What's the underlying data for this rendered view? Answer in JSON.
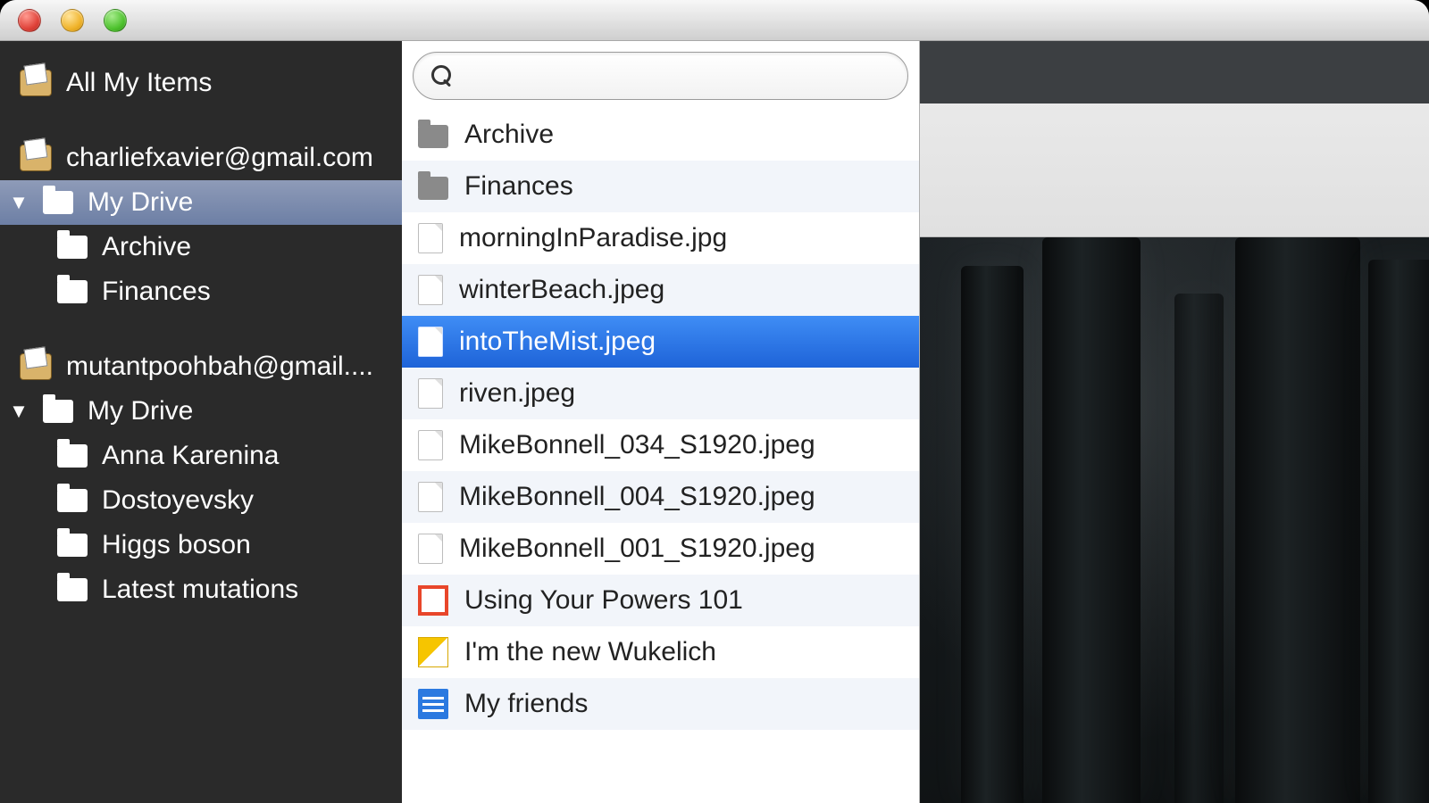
{
  "sidebar": {
    "all_items_label": "All My Items",
    "accounts": [
      {
        "email": "charliefxavier@gmail.com",
        "drive_label": "My Drive",
        "selected": true,
        "folders": [
          "Archive",
          "Finances"
        ]
      },
      {
        "email": "mutantpoohbah@gmail....",
        "drive_label": "My Drive",
        "selected": false,
        "folders": [
          "Anna Karenina",
          "Dostoyevsky",
          "Higgs boson",
          "Latest mutations"
        ]
      }
    ]
  },
  "search": {
    "placeholder": ""
  },
  "files": [
    {
      "name": "Archive",
      "type": "folder",
      "selected": false
    },
    {
      "name": "Finances",
      "type": "folder",
      "selected": false
    },
    {
      "name": "morningInParadise.jpg",
      "type": "file",
      "selected": false
    },
    {
      "name": "winterBeach.jpeg",
      "type": "file",
      "selected": false
    },
    {
      "name": "intoTheMist.jpeg",
      "type": "file",
      "selected": true
    },
    {
      "name": "riven.jpeg",
      "type": "file",
      "selected": false
    },
    {
      "name": "MikeBonnell_034_S1920.jpeg",
      "type": "file",
      "selected": false
    },
    {
      "name": "MikeBonnell_004_S1920.jpeg",
      "type": "file",
      "selected": false
    },
    {
      "name": "MikeBonnell_001_S1920.jpeg",
      "type": "file",
      "selected": false
    },
    {
      "name": "Using Your Powers 101",
      "type": "slides",
      "selected": false
    },
    {
      "name": "I'm the new Wukelich",
      "type": "drawing",
      "selected": false
    },
    {
      "name": "My friends",
      "type": "gdoc",
      "selected": false
    }
  ]
}
